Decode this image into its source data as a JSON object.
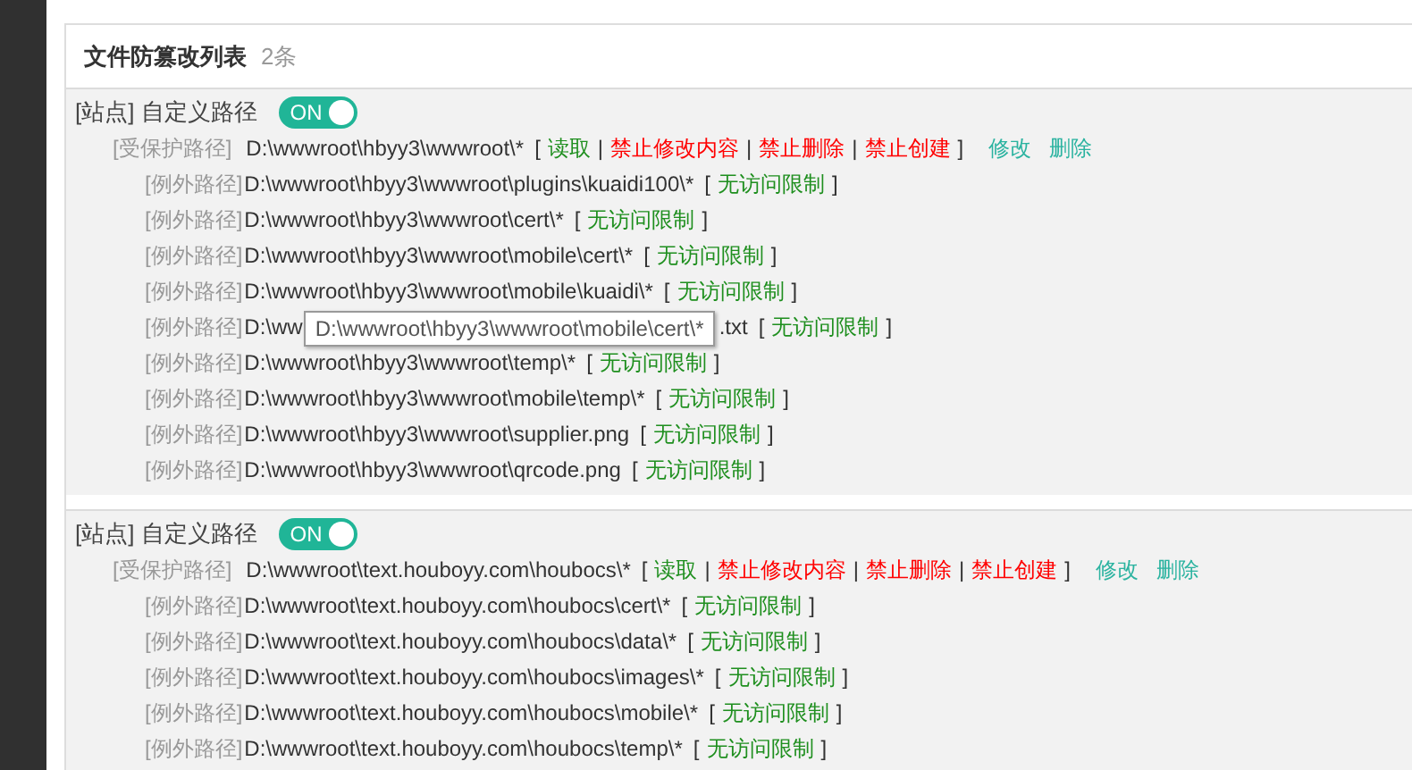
{
  "panel": {
    "title": "文件防篡改列表",
    "count": "2条"
  },
  "groups": [
    {
      "tag": "[站点]",
      "title": "自定义路径",
      "toggle": {
        "label": "ON",
        "on": true
      },
      "protected": {
        "label": "[受保护路径]",
        "path": "D:\\wwwroot\\hbyy3\\wwwroot\\*",
        "rules": [
          {
            "kind": "bracket",
            "text": "["
          },
          {
            "kind": "allow",
            "text": "读取"
          },
          {
            "kind": "separator",
            "text": "|"
          },
          {
            "kind": "deny",
            "text": "禁止修改内容"
          },
          {
            "kind": "separator",
            "text": "|"
          },
          {
            "kind": "deny",
            "text": "禁止删除"
          },
          {
            "kind": "separator",
            "text": "|"
          },
          {
            "kind": "deny",
            "text": "禁止创建"
          },
          {
            "kind": "bracket",
            "text": "]"
          }
        ],
        "actions": [
          "修改",
          "删除"
        ]
      },
      "exceptions": [
        {
          "label": "[例外路径]",
          "path": "D:\\wwwroot\\hbyy3\\wwwroot\\plugins\\kuaidi100\\*",
          "rules": [
            {
              "kind": "bracket",
              "text": "["
            },
            {
              "kind": "allow",
              "text": "无访问限制"
            },
            {
              "kind": "bracket",
              "text": "]"
            }
          ]
        },
        {
          "label": "[例外路径]",
          "path": "D:\\wwwroot\\hbyy3\\wwwroot\\cert\\*",
          "rules": [
            {
              "kind": "bracket",
              "text": "["
            },
            {
              "kind": "allow",
              "text": "无访问限制"
            },
            {
              "kind": "bracket",
              "text": "]"
            }
          ]
        },
        {
          "label": "[例外路径]",
          "path": "D:\\wwwroot\\hbyy3\\wwwroot\\mobile\\cert\\*",
          "rules": [
            {
              "kind": "bracket",
              "text": "["
            },
            {
              "kind": "allow",
              "text": "无访问限制"
            },
            {
              "kind": "bracket",
              "text": "]"
            }
          ]
        },
        {
          "label": "[例外路径]",
          "path": "D:\\wwwroot\\hbyy3\\wwwroot\\mobile\\kuaidi\\*",
          "rules": [
            {
              "kind": "bracket",
              "text": "["
            },
            {
              "kind": "allow",
              "text": "无访问限制"
            },
            {
              "kind": "bracket",
              "text": "]"
            }
          ]
        },
        {
          "label": "[例外路径]",
          "path": "D:\\ww",
          "path_end": ".txt",
          "tooltip": "D:\\wwwroot\\hbyy3\\wwwroot\\mobile\\cert\\*",
          "rules": [
            {
              "kind": "bracket",
              "text": "["
            },
            {
              "kind": "allow",
              "text": "无访问限制"
            },
            {
              "kind": "bracket",
              "text": "]"
            }
          ]
        },
        {
          "label": "[例外路径]",
          "path": "D:\\wwwroot\\hbyy3\\wwwroot\\temp\\*",
          "rules": [
            {
              "kind": "bracket",
              "text": "["
            },
            {
              "kind": "allow",
              "text": "无访问限制"
            },
            {
              "kind": "bracket",
              "text": "]"
            }
          ]
        },
        {
          "label": "[例外路径]",
          "path": "D:\\wwwroot\\hbyy3\\wwwroot\\mobile\\temp\\*",
          "rules": [
            {
              "kind": "bracket",
              "text": "["
            },
            {
              "kind": "allow",
              "text": "无访问限制"
            },
            {
              "kind": "bracket",
              "text": "]"
            }
          ]
        },
        {
          "label": "[例外路径]",
          "path": "D:\\wwwroot\\hbyy3\\wwwroot\\supplier.png",
          "rules": [
            {
              "kind": "bracket",
              "text": "["
            },
            {
              "kind": "allow",
              "text": "无访问限制"
            },
            {
              "kind": "bracket",
              "text": "]"
            }
          ]
        },
        {
          "label": "[例外路径]",
          "path": "D:\\wwwroot\\hbyy3\\wwwroot\\qrcode.png",
          "rules": [
            {
              "kind": "bracket",
              "text": "["
            },
            {
              "kind": "allow",
              "text": "无访问限制"
            },
            {
              "kind": "bracket",
              "text": "]"
            }
          ]
        }
      ]
    },
    {
      "tag": "[站点]",
      "title": "自定义路径",
      "toggle": {
        "label": "ON",
        "on": true
      },
      "protected": {
        "label": "[受保护路径]",
        "path": "D:\\wwwroot\\text.houboyy.com\\houbocs\\*",
        "rules": [
          {
            "kind": "bracket",
            "text": "["
          },
          {
            "kind": "allow",
            "text": "读取"
          },
          {
            "kind": "separator",
            "text": "|"
          },
          {
            "kind": "deny",
            "text": "禁止修改内容"
          },
          {
            "kind": "separator",
            "text": "|"
          },
          {
            "kind": "deny",
            "text": "禁止删除"
          },
          {
            "kind": "separator",
            "text": "|"
          },
          {
            "kind": "deny",
            "text": "禁止创建"
          },
          {
            "kind": "bracket",
            "text": "]"
          }
        ],
        "actions": [
          "修改",
          "删除"
        ]
      },
      "exceptions": [
        {
          "label": "[例外路径]",
          "path": "D:\\wwwroot\\text.houboyy.com\\houbocs\\cert\\*",
          "rules": [
            {
              "kind": "bracket",
              "text": "["
            },
            {
              "kind": "allow",
              "text": "无访问限制"
            },
            {
              "kind": "bracket",
              "text": "]"
            }
          ]
        },
        {
          "label": "[例外路径]",
          "path": "D:\\wwwroot\\text.houboyy.com\\houbocs\\data\\*",
          "rules": [
            {
              "kind": "bracket",
              "text": "["
            },
            {
              "kind": "allow",
              "text": "无访问限制"
            },
            {
              "kind": "bracket",
              "text": "]"
            }
          ]
        },
        {
          "label": "[例外路径]",
          "path": "D:\\wwwroot\\text.houboyy.com\\houbocs\\images\\*",
          "rules": [
            {
              "kind": "bracket",
              "text": "["
            },
            {
              "kind": "allow",
              "text": "无访问限制"
            },
            {
              "kind": "bracket",
              "text": "]"
            }
          ]
        },
        {
          "label": "[例外路径]",
          "path": "D:\\wwwroot\\text.houboyy.com\\houbocs\\mobile\\*",
          "rules": [
            {
              "kind": "bracket",
              "text": "["
            },
            {
              "kind": "allow",
              "text": "无访问限制"
            },
            {
              "kind": "bracket",
              "text": "]"
            }
          ]
        },
        {
          "label": "[例外路径]",
          "path": "D:\\wwwroot\\text.houboyy.com\\houbocs\\temp\\*",
          "rules": [
            {
              "kind": "bracket",
              "text": "["
            },
            {
              "kind": "allow",
              "text": "无访问限制"
            },
            {
              "kind": "bracket",
              "text": "]"
            }
          ]
        }
      ]
    }
  ]
}
